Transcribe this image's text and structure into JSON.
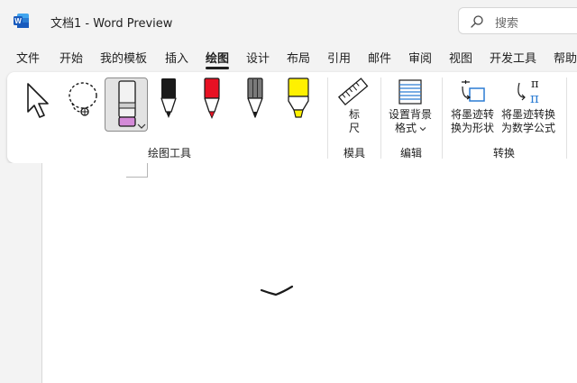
{
  "window": {
    "doc_title": "文档1  -  Word Preview",
    "search_placeholder": "搜索"
  },
  "tabs": [
    {
      "label": "文件"
    },
    {
      "label": "开始"
    },
    {
      "label": "我的模板"
    },
    {
      "label": "插入"
    },
    {
      "label": "绘图"
    },
    {
      "label": "设计"
    },
    {
      "label": "布局"
    },
    {
      "label": "引用"
    },
    {
      "label": "邮件"
    },
    {
      "label": "审阅"
    },
    {
      "label": "视图"
    },
    {
      "label": "开发工具"
    },
    {
      "label": "帮助"
    }
  ],
  "active_tab": "绘图",
  "ribbon": {
    "groups": {
      "draw_tools": "绘图工具",
      "stencils": "模具",
      "edit": "编辑",
      "convert": "转换"
    },
    "ruler_label_1": "标",
    "ruler_label_2": "尺",
    "background_format_1": "设置背景",
    "background_format_2": "格式",
    "ink_to_shape_1": "将墨迹转",
    "ink_to_shape_2": "换为形状",
    "ink_to_math_1": "将墨迹转换",
    "ink_to_math_2": "为数学公式"
  },
  "colors": {
    "pen_black": "#1a1a1a",
    "pen_red": "#e81123",
    "pencil_gray": "#7a7a7a",
    "highlighter_yellow": "#fff100",
    "eraser_pink": "#d48ad8",
    "accent_blue": "#2b7cd3"
  }
}
